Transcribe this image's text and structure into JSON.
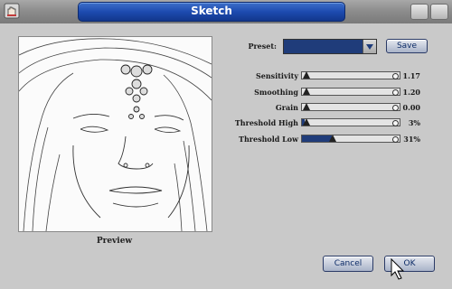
{
  "window": {
    "title": "Sketch"
  },
  "preview": {
    "label": "Preview"
  },
  "preset": {
    "label": "Preset:",
    "value": "",
    "save_label": "Save"
  },
  "sliders": [
    {
      "label": "Sensitivity",
      "value_text": "1.17",
      "fraction": 0.0
    },
    {
      "label": "Smoothing",
      "value_text": "1.20",
      "fraction": 0.0
    },
    {
      "label": "Grain",
      "value_text": "0.00",
      "fraction": 0.0
    },
    {
      "label": "Threshold High",
      "value_text": "3%",
      "fraction": 0.03
    },
    {
      "label": "Threshold Low",
      "value_text": "31%",
      "fraction": 0.31
    }
  ],
  "buttons": {
    "cancel": "Cancel",
    "ok": "OK"
  },
  "colors": {
    "title_accent": "#1d4bb0",
    "window_bg": "#c9c9c9",
    "slider_fill": "#1f3c7a"
  }
}
